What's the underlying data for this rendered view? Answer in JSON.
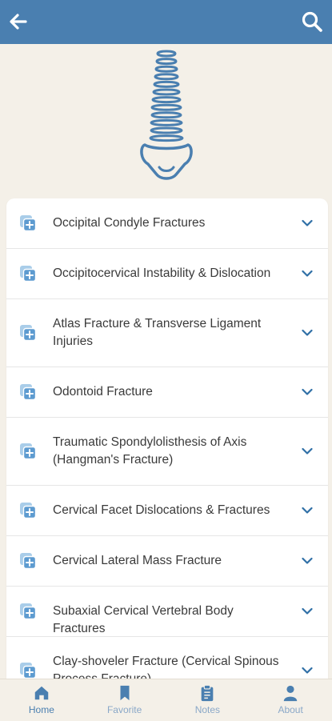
{
  "header": {
    "back_icon": "arrow-left-icon",
    "search_icon": "search-icon",
    "color": "#4a7fb0"
  },
  "hero": {
    "icon": "spine-illustration"
  },
  "list": {
    "items": [
      {
        "label": "Occipital Condyle Fractures"
      },
      {
        "label": "Occipitocervical Instability & Dislocation"
      },
      {
        "label": "Atlas Fracture & Transverse Ligament Injuries"
      },
      {
        "label": "Odontoid Fracture"
      },
      {
        "label": "Traumatic Spondylolisthesis of Axis (Hangman's Fracture)"
      },
      {
        "label": "Cervical Facet Dislocations & Fractures"
      },
      {
        "label": "Cervical Lateral Mass Fracture"
      },
      {
        "label": "Subaxial Cervical Vertebral Body Fractures"
      },
      {
        "label": "Clay-shoveler Fracture (Cervical Spinous Process Fracture)"
      }
    ]
  },
  "tabbar": {
    "tabs": [
      {
        "label": "Home",
        "icon": "home-icon"
      },
      {
        "label": "Favorite",
        "icon": "bookmark-icon"
      },
      {
        "label": "Notes",
        "icon": "clipboard-icon"
      },
      {
        "label": "About",
        "icon": "user-icon"
      }
    ]
  },
  "colors": {
    "accent": "#4a7fb0",
    "icon_light": "#6fa3cf",
    "background": "#f4f0e8"
  }
}
